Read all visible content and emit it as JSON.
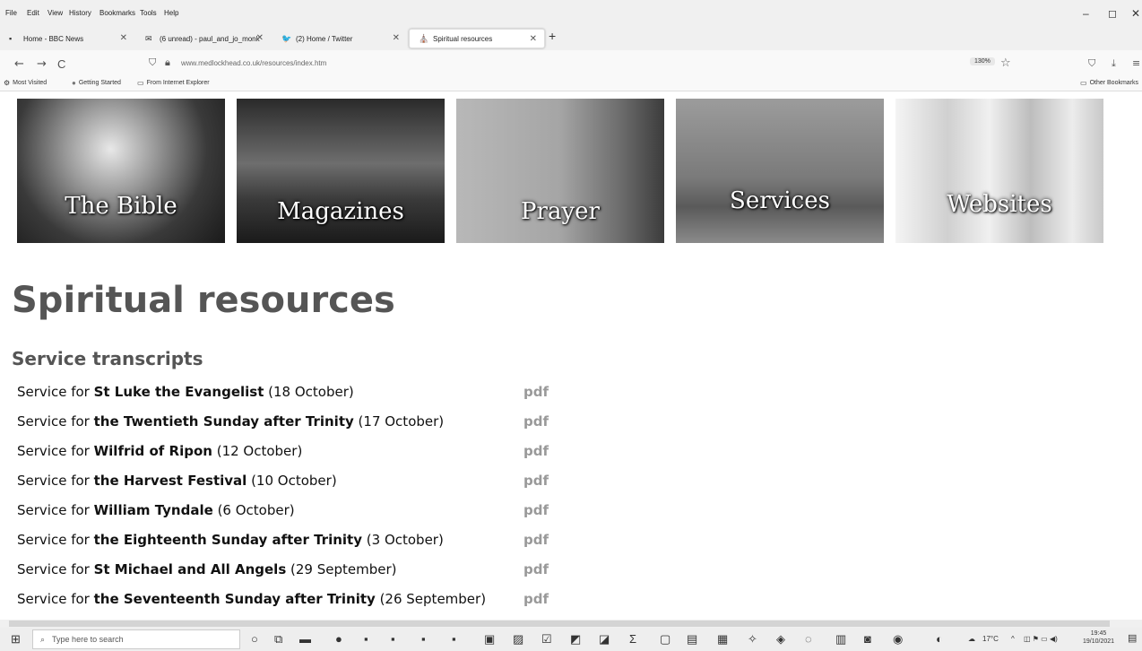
{
  "menubar": {
    "items": [
      "File",
      "Edit",
      "View",
      "History",
      "Bookmarks",
      "Tools",
      "Help"
    ],
    "minimize": "–",
    "maximize": "◻",
    "close": "✕"
  },
  "tabs": [
    {
      "label": "Home - BBC News",
      "icon": "bbc-icon",
      "glyph": "▪"
    },
    {
      "label": "(6 unread) - paul_and_jo_monk",
      "icon": "mail-icon",
      "glyph": "✉"
    },
    {
      "label": "(2) Home / Twitter",
      "icon": "twitter-icon",
      "glyph": "🐦"
    },
    {
      "label": "Spiritual resources",
      "icon": "site-icon",
      "glyph": "⛪"
    }
  ],
  "new_tab": "+",
  "tab_close": "✕",
  "nav": {
    "back": "←",
    "forward": "→",
    "reload": "C",
    "url": "www.medlockhead.co.uk/resources/index.htm",
    "zoom": "130%",
    "star": "☆"
  },
  "bookmarks": [
    {
      "label": "Most Visited",
      "glyph": "⚙"
    },
    {
      "label": "Getting Started",
      "glyph": "●"
    },
    {
      "label": "From Internet Explorer",
      "glyph": "▭"
    }
  ],
  "other_bookmarks": "Other Bookmarks",
  "banner": {
    "tiles": [
      {
        "label": "The Bible"
      },
      {
        "label": "Magazines"
      },
      {
        "label": "Prayer"
      },
      {
        "label": "Services"
      },
      {
        "label": "Websites"
      }
    ]
  },
  "page": {
    "title": "Spiritual resources",
    "section_title": "Service transcripts"
  },
  "services": [
    {
      "prefix": "Service for ",
      "name": "St Luke the Evangelist",
      "date": "(18 October)",
      "link": "pdf"
    },
    {
      "prefix": "Service for ",
      "name": "the Twentieth Sunday after Trinity",
      "date": "(17 October)",
      "link": "pdf"
    },
    {
      "prefix": "Service for ",
      "name": "Wilfrid of Ripon",
      "date": "(12 October)",
      "link": "pdf"
    },
    {
      "prefix": "Service for ",
      "name": "the Harvest Festival",
      "date": "(10 October)",
      "link": "pdf"
    },
    {
      "prefix": "Service for ",
      "name": "William Tyndale",
      "date": "(6 October)",
      "link": "pdf"
    },
    {
      "prefix": "Service for ",
      "name": "the Eighteenth Sunday after Trinity",
      "date": "(3 October)",
      "link": "pdf"
    },
    {
      "prefix": "Service for ",
      "name": "St Michael and All Angels",
      "date": "(29 September)",
      "link": "pdf"
    },
    {
      "prefix": "Service for ",
      "name": "the Seventeenth Sunday after Trinity",
      "date": "(26 September)",
      "link": "pdf"
    }
  ],
  "taskbar": {
    "search_placeholder": "Type here to search",
    "temperature": "17°C",
    "time": "19:45",
    "date": "19/10/2021"
  }
}
